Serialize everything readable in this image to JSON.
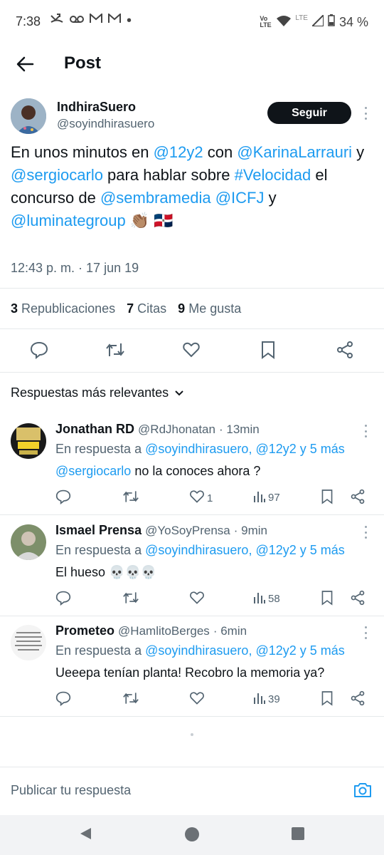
{
  "status": {
    "time": "7:38",
    "battery": "34 %",
    "net1": "Vo LTE",
    "net2": "LTE"
  },
  "header": {
    "title": "Post"
  },
  "tweet": {
    "name": "IndhiraSuero",
    "handle": "@soyindhirasuero",
    "follow_label": "Seguir",
    "segments": [
      {
        "t": "En unos minutos en ",
        "link": false
      },
      {
        "t": "@12y2",
        "link": true
      },
      {
        "t": "  con ",
        "link": false
      },
      {
        "t": "@KarinaLarrauri",
        "link": true
      },
      {
        "t": " y ",
        "link": false
      },
      {
        "t": "@sergiocarlo",
        "link": true
      },
      {
        "t": " para hablar sobre ",
        "link": false
      },
      {
        "t": "#Velocidad",
        "link": true
      },
      {
        "t": " el concurso de ",
        "link": false
      },
      {
        "t": "@sembramedia",
        "link": true
      },
      {
        "t": "  ",
        "link": false
      },
      {
        "t": "@ICFJ",
        "link": true
      },
      {
        "t": "  y ",
        "link": false
      },
      {
        "t": "@luminategroup",
        "link": true
      },
      {
        "t": " 👏🏽 🇩🇴",
        "link": false
      }
    ],
    "timestamp": "12:43 p. m. · 17 jun 19",
    "stats": {
      "reposts_count": "3",
      "reposts_label": "Republicaciones",
      "quotes_count": "7",
      "quotes_label": "Citas",
      "likes_count": "9",
      "likes_label": "Me gusta"
    }
  },
  "sort": {
    "label": "Respuestas más relevantes"
  },
  "replies": [
    {
      "name": "Jonathan RD",
      "handle": "@RdJhonatan",
      "time": "· 13min",
      "reply_to_prefix": "En respuesta a ",
      "reply_to": "@soyindhirasuero, @12y2 y 5 más",
      "text_link": "@sergiocarlo",
      "text": " no la conoces ahora ?",
      "likes": "1",
      "views": "97"
    },
    {
      "name": "Ismael Prensa",
      "handle": "@YoSoyPrensa",
      "time": "· 9min",
      "reply_to_prefix": "En respuesta a ",
      "reply_to": "@soyindhirasuero, @12y2 y 5 más",
      "text_link": "",
      "text": "El hueso 💀💀💀",
      "likes": "",
      "views": "58"
    },
    {
      "name": "Prometeo",
      "handle": "@HamlitoBerges",
      "time": "· 6min",
      "reply_to_prefix": "En respuesta a ",
      "reply_to": "@soyindhirasuero, @12y2 y 5 más",
      "text_link": "",
      "text": "Ueeepa tenían planta! Recobro la memoria ya?",
      "likes": "",
      "views": "39"
    }
  ],
  "compose": {
    "placeholder": "Publicar tu respuesta"
  }
}
